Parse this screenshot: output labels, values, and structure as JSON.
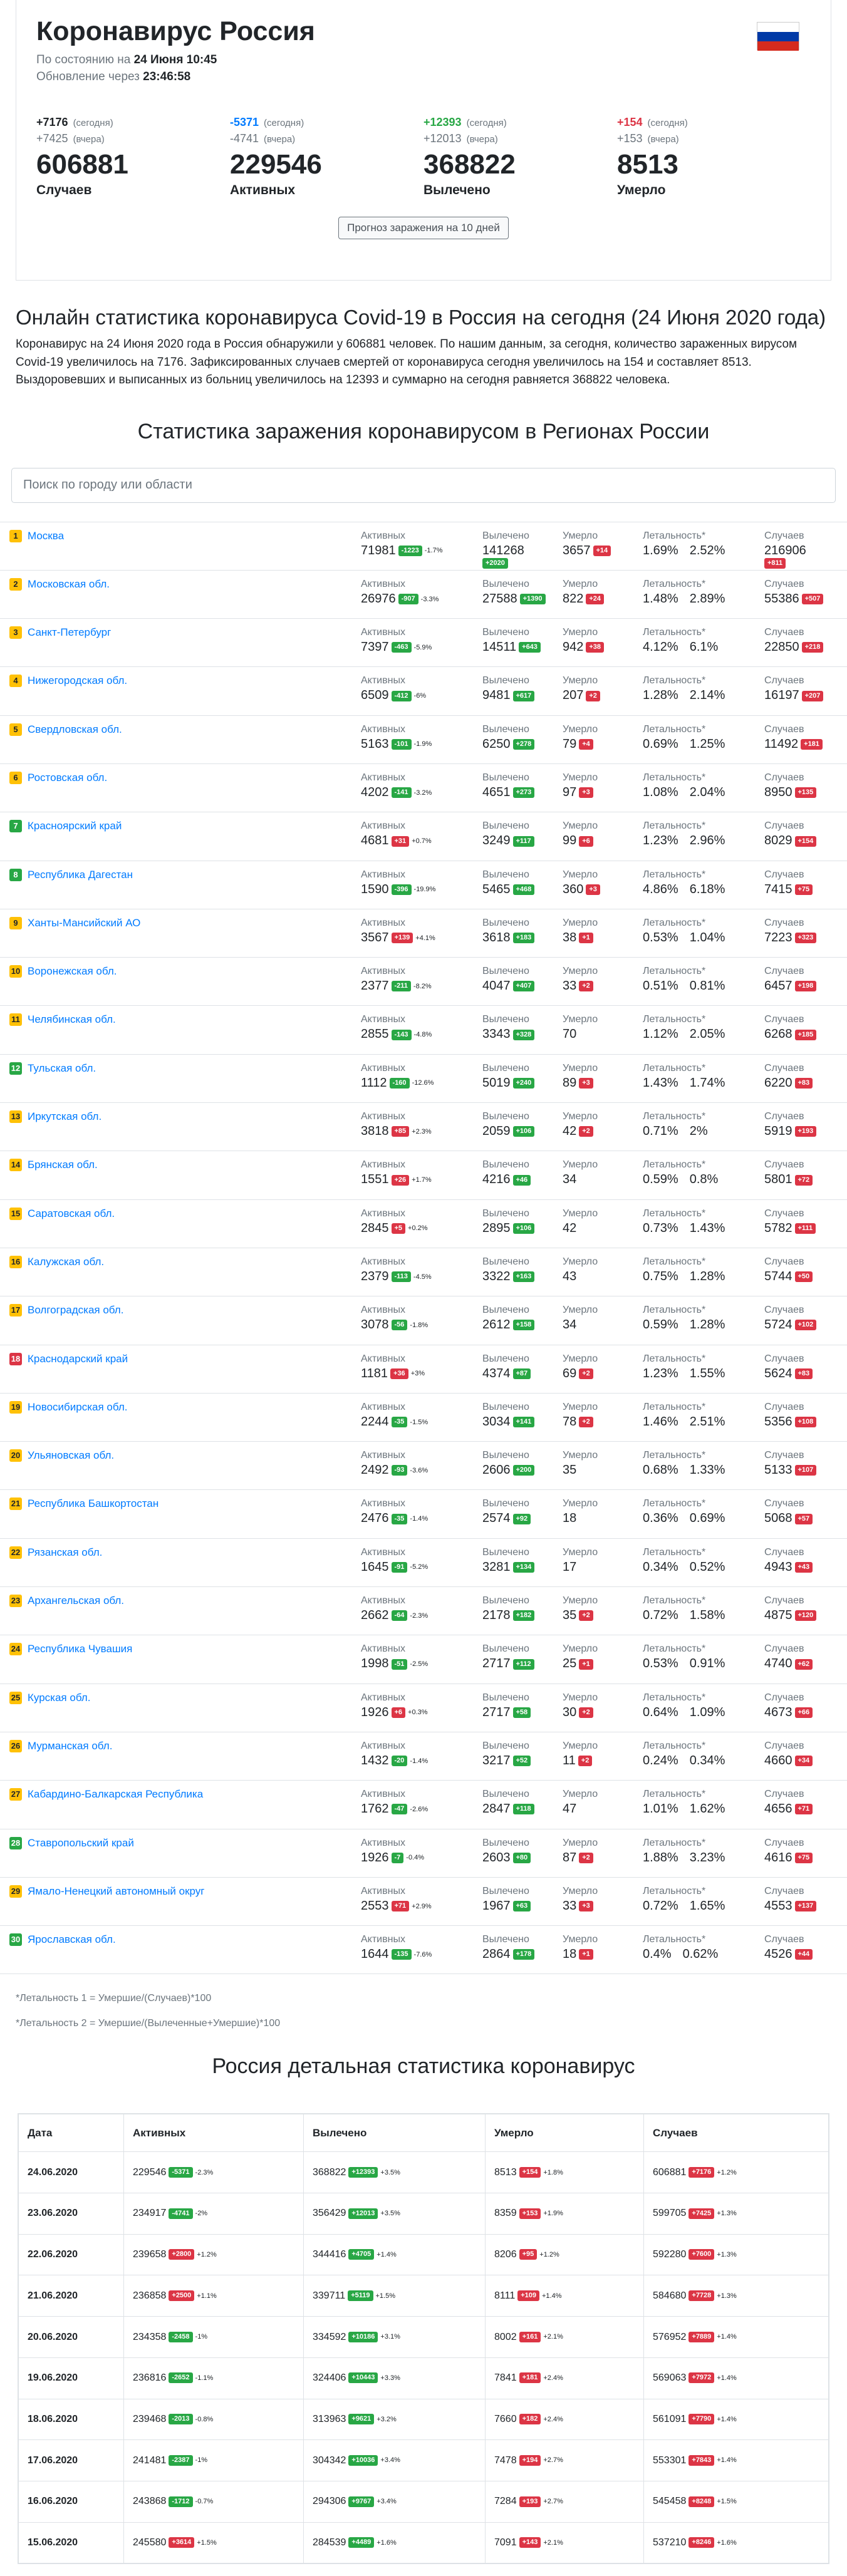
{
  "header": {
    "title": "Коронавирус Россия",
    "status_prefix": "По состоянию на",
    "status_date": "24 Июня 10:45",
    "update_prefix": "Обновление через",
    "update_timer": "23:46:58",
    "flag_colors": [
      "#ffffff",
      "#0039a6",
      "#d52b1e"
    ]
  },
  "stats": [
    {
      "today": "+7176",
      "yesterday": "+7425",
      "total": "606881",
      "label": "Случаев",
      "color": "#212529"
    },
    {
      "today": "-5371",
      "yesterday": "-4741",
      "total": "229546",
      "label": "Активных",
      "color": "#007bff"
    },
    {
      "today": "+12393",
      "yesterday": "+12013",
      "total": "368822",
      "label": "Вылечено",
      "color": "#28a745"
    },
    {
      "today": "+154",
      "yesterday": "+153",
      "total": "8513",
      "label": "Умерло",
      "color": "#dc3545"
    }
  ],
  "stat_labels": {
    "today": "(сегодня)",
    "yesterday": "(вчера)"
  },
  "forecast_button": "Прогноз заражения на 10 дней",
  "intro": {
    "heading": "Онлайн статистика коронавируса Covid-19 в Россия на сегодня (24 Июня 2020 года)",
    "text": "Коронавирус на 24 Июня 2020 года в Россия обнаружили у 606881 человек. По нашим данным, за сегодня, количество зараженных вирусом Covid-19 увеличилось на 7176. Зафиксированных случаев смертей от коронавируса сегодня увеличилось на 154 и составляет 8513. Выздоровевших и выписанных из больниц увеличилось на 12393 и суммарно на сегодня равняется 368822 человека."
  },
  "regions_title": "Статистика заражения коронавирусом в Регионах России",
  "search_placeholder": "Поиск по городу или области",
  "region_labels": {
    "active": "Активных",
    "recovered": "Вылечено",
    "deaths": "Умерло",
    "lethality": "Летальность*",
    "cases": "Случаев"
  },
  "regions": [
    {
      "n": "1",
      "c": "y",
      "name": "Москва",
      "active": "71981",
      "ad": "-1223",
      "ap": "-1.7%",
      "rec": "141268",
      "rd": "+2020",
      "dth": "3657",
      "dd": "+14",
      "l1": "1.69%",
      "l2": "2.52%",
      "cas": "216906",
      "cd": "+811"
    },
    {
      "n": "2",
      "c": "y",
      "name": "Московская обл.",
      "active": "26976",
      "ad": "-907",
      "ap": "-3.3%",
      "rec": "27588",
      "rd": "+1390",
      "dth": "822",
      "dd": "+24",
      "l1": "1.48%",
      "l2": "2.89%",
      "cas": "55386",
      "cd": "+507"
    },
    {
      "n": "3",
      "c": "y",
      "name": "Санкт-Петербург",
      "active": "7397",
      "ad": "-463",
      "ap": "-5.9%",
      "rec": "14511",
      "rd": "+643",
      "dth": "942",
      "dd": "+38",
      "l1": "4.12%",
      "l2": "6.1%",
      "cas": "22850",
      "cd": "+218"
    },
    {
      "n": "4",
      "c": "y",
      "name": "Нижегородская обл.",
      "active": "6509",
      "ad": "-412",
      "ap": "-6%",
      "rec": "9481",
      "rd": "+617",
      "dth": "207",
      "dd": "+2",
      "l1": "1.28%",
      "l2": "2.14%",
      "cas": "16197",
      "cd": "+207"
    },
    {
      "n": "5",
      "c": "y",
      "name": "Свердловская обл.",
      "active": "5163",
      "ad": "-101",
      "ap": "-1.9%",
      "rec": "6250",
      "rd": "+278",
      "dth": "79",
      "dd": "+4",
      "l1": "0.69%",
      "l2": "1.25%",
      "cas": "11492",
      "cd": "+181"
    },
    {
      "n": "6",
      "c": "y",
      "name": "Ростовская обл.",
      "active": "4202",
      "ad": "-141",
      "ap": "-3.2%",
      "rec": "4651",
      "rd": "+273",
      "dth": "97",
      "dd": "+3",
      "l1": "1.08%",
      "l2": "2.04%",
      "cas": "8950",
      "cd": "+135"
    },
    {
      "n": "7",
      "c": "g",
      "name": "Красноярский край",
      "active": "4681",
      "ad": "+31",
      "ap": "+0.7%",
      "rec": "3249",
      "rd": "+117",
      "dth": "99",
      "dd": "+6",
      "l1": "1.23%",
      "l2": "2.96%",
      "cas": "8029",
      "cd": "+154"
    },
    {
      "n": "8",
      "c": "g",
      "name": "Республика Дагестан",
      "active": "1590",
      "ad": "-396",
      "ap": "-19.9%",
      "rec": "5465",
      "rd": "+468",
      "dth": "360",
      "dd": "+3",
      "l1": "4.86%",
      "l2": "6.18%",
      "cas": "7415",
      "cd": "+75"
    },
    {
      "n": "9",
      "c": "y",
      "name": "Ханты-Мансийский АО",
      "active": "3567",
      "ad": "+139",
      "ap": "+4.1%",
      "rec": "3618",
      "rd": "+183",
      "dth": "38",
      "dd": "+1",
      "l1": "0.53%",
      "l2": "1.04%",
      "cas": "7223",
      "cd": "+323"
    },
    {
      "n": "10",
      "c": "y",
      "name": "Воронежская обл.",
      "active": "2377",
      "ad": "-211",
      "ap": "-8.2%",
      "rec": "4047",
      "rd": "+407",
      "dth": "33",
      "dd": "+2",
      "l1": "0.51%",
      "l2": "0.81%",
      "cas": "6457",
      "cd": "+198"
    },
    {
      "n": "11",
      "c": "y",
      "name": "Челябинская обл.",
      "active": "2855",
      "ad": "-143",
      "ap": "-4.8%",
      "rec": "3343",
      "rd": "+328",
      "dth": "70",
      "dd": "",
      "l1": "1.12%",
      "l2": "2.05%",
      "cas": "6268",
      "cd": "+185"
    },
    {
      "n": "12",
      "c": "g",
      "name": "Тульская обл.",
      "active": "1112",
      "ad": "-160",
      "ap": "-12.6%",
      "rec": "5019",
      "rd": "+240",
      "dth": "89",
      "dd": "+3",
      "l1": "1.43%",
      "l2": "1.74%",
      "cas": "6220",
      "cd": "+83"
    },
    {
      "n": "13",
      "c": "y",
      "name": "Иркутская обл.",
      "active": "3818",
      "ad": "+85",
      "ap": "+2.3%",
      "rec": "2059",
      "rd": "+106",
      "dth": "42",
      "dd": "+2",
      "l1": "0.71%",
      "l2": "2%",
      "cas": "5919",
      "cd": "+193"
    },
    {
      "n": "14",
      "c": "y",
      "name": "Брянская обл.",
      "active": "1551",
      "ad": "+26",
      "ap": "+1.7%",
      "rec": "4216",
      "rd": "+46",
      "dth": "34",
      "dd": "",
      "l1": "0.59%",
      "l2": "0.8%",
      "cas": "5801",
      "cd": "+72"
    },
    {
      "n": "15",
      "c": "y",
      "name": "Саратовская обл.",
      "active": "2845",
      "ad": "+5",
      "ap": "+0.2%",
      "rec": "2895",
      "rd": "+106",
      "dth": "42",
      "dd": "",
      "l1": "0.73%",
      "l2": "1.43%",
      "cas": "5782",
      "cd": "+111"
    },
    {
      "n": "16",
      "c": "y",
      "name": "Калужская обл.",
      "active": "2379",
      "ad": "-113",
      "ap": "-4.5%",
      "rec": "3322",
      "rd": "+163",
      "dth": "43",
      "dd": "",
      "l1": "0.75%",
      "l2": "1.28%",
      "cas": "5744",
      "cd": "+50"
    },
    {
      "n": "17",
      "c": "y",
      "name": "Волгоградская обл.",
      "active": "3078",
      "ad": "-56",
      "ap": "-1.8%",
      "rec": "2612",
      "rd": "+158",
      "dth": "34",
      "dd": "",
      "l1": "0.59%",
      "l2": "1.28%",
      "cas": "5724",
      "cd": "+102"
    },
    {
      "n": "18",
      "c": "r",
      "name": "Краснодарский край",
      "active": "1181",
      "ad": "+36",
      "ap": "+3%",
      "rec": "4374",
      "rd": "+87",
      "dth": "69",
      "dd": "+2",
      "l1": "1.23%",
      "l2": "1.55%",
      "cas": "5624",
      "cd": "+83"
    },
    {
      "n": "19",
      "c": "y",
      "name": "Новосибирская обл.",
      "active": "2244",
      "ad": "-35",
      "ap": "-1.5%",
      "rec": "3034",
      "rd": "+141",
      "dth": "78",
      "dd": "+2",
      "l1": "1.46%",
      "l2": "2.51%",
      "cas": "5356",
      "cd": "+108"
    },
    {
      "n": "20",
      "c": "y",
      "name": "Ульяновская обл.",
      "active": "2492",
      "ad": "-93",
      "ap": "-3.6%",
      "rec": "2606",
      "rd": "+200",
      "dth": "35",
      "dd": "",
      "l1": "0.68%",
      "l2": "1.33%",
      "cas": "5133",
      "cd": "+107"
    },
    {
      "n": "21",
      "c": "y",
      "name": "Республика Башкортостан",
      "active": "2476",
      "ad": "-35",
      "ap": "-1.4%",
      "rec": "2574",
      "rd": "+92",
      "dth": "18",
      "dd": "",
      "l1": "0.36%",
      "l2": "0.69%",
      "cas": "5068",
      "cd": "+57"
    },
    {
      "n": "22",
      "c": "y",
      "name": "Рязанская обл.",
      "active": "1645",
      "ad": "-91",
      "ap": "-5.2%",
      "rec": "3281",
      "rd": "+134",
      "dth": "17",
      "dd": "",
      "l1": "0.34%",
      "l2": "0.52%",
      "cas": "4943",
      "cd": "+43"
    },
    {
      "n": "23",
      "c": "y",
      "name": "Архангельская обл.",
      "active": "2662",
      "ad": "-64",
      "ap": "-2.3%",
      "rec": "2178",
      "rd": "+182",
      "dth": "35",
      "dd": "+2",
      "l1": "0.72%",
      "l2": "1.58%",
      "cas": "4875",
      "cd": "+120"
    },
    {
      "n": "24",
      "c": "y",
      "name": "Республика Чувашия",
      "active": "1998",
      "ad": "-51",
      "ap": "-2.5%",
      "rec": "2717",
      "rd": "+112",
      "dth": "25",
      "dd": "+1",
      "l1": "0.53%",
      "l2": "0.91%",
      "cas": "4740",
      "cd": "+62"
    },
    {
      "n": "25",
      "c": "y",
      "name": "Курская обл.",
      "active": "1926",
      "ad": "+6",
      "ap": "+0.3%",
      "rec": "2717",
      "rd": "+58",
      "dth": "30",
      "dd": "+2",
      "l1": "0.64%",
      "l2": "1.09%",
      "cas": "4673",
      "cd": "+66"
    },
    {
      "n": "26",
      "c": "y",
      "name": "Мурманская обл.",
      "active": "1432",
      "ad": "-20",
      "ap": "-1.4%",
      "rec": "3217",
      "rd": "+52",
      "dth": "11",
      "dd": "+2",
      "l1": "0.24%",
      "l2": "0.34%",
      "cas": "4660",
      "cd": "+34"
    },
    {
      "n": "27",
      "c": "y",
      "name": "Кабардино-Балкарская Республика",
      "active": "1762",
      "ad": "-47",
      "ap": "-2.6%",
      "rec": "2847",
      "rd": "+118",
      "dth": "47",
      "dd": "",
      "l1": "1.01%",
      "l2": "1.62%",
      "cas": "4656",
      "cd": "+71"
    },
    {
      "n": "28",
      "c": "g",
      "name": "Ставропольский край",
      "active": "1926",
      "ad": "-7",
      "ap": "-0.4%",
      "rec": "2603",
      "rd": "+80",
      "dth": "87",
      "dd": "+2",
      "l1": "1.88%",
      "l2": "3.23%",
      "cas": "4616",
      "cd": "+75"
    },
    {
      "n": "29",
      "c": "y",
      "name": "Ямало-Ненецкий автономный округ",
      "active": "2553",
      "ad": "+71",
      "ap": "+2.9%",
      "rec": "1967",
      "rd": "+63",
      "dth": "33",
      "dd": "+3",
      "l1": "0.72%",
      "l2": "1.65%",
      "cas": "4553",
      "cd": "+137"
    },
    {
      "n": "30",
      "c": "g",
      "name": "Ярославская обл.",
      "active": "1644",
      "ad": "-135",
      "ap": "-7.6%",
      "rec": "2864",
      "rd": "+178",
      "dth": "18",
      "dd": "+1",
      "l1": "0.4%",
      "l2": "0.62%",
      "cas": "4526",
      "cd": "+44"
    }
  ],
  "notes": {
    "n1": "*Летальность 1 = Умершие/(Случаев)*100",
    "n2": "*Летальность 2 = Умершие/(Вылеченные+Умершие)*100"
  },
  "daily_title": "Россия детальная статистика коронавирус",
  "daily_headers": [
    "Дата",
    "Активных",
    "Вылечено",
    "Умерло",
    "Случаев"
  ],
  "daily": [
    {
      "date": "24.06.2020",
      "a": "229546",
      "ad": "-5371",
      "ap": "-2.3%",
      "r": "368822",
      "rd": "+12393",
      "rp": "+3.5%",
      "d": "8513",
      "dd": "+154",
      "dp": "+1.8%",
      "c": "606881",
      "cd": "+7176",
      "cp": "+1.2%"
    },
    {
      "date": "23.06.2020",
      "a": "234917",
      "ad": "-4741",
      "ap": "-2%",
      "r": "356429",
      "rd": "+12013",
      "rp": "+3.5%",
      "d": "8359",
      "dd": "+153",
      "dp": "+1.9%",
      "c": "599705",
      "cd": "+7425",
      "cp": "+1.3%"
    },
    {
      "date": "22.06.2020",
      "a": "239658",
      "ad": "+2800",
      "ap": "+1.2%",
      "r": "344416",
      "rd": "+4705",
      "rp": "+1.4%",
      "d": "8206",
      "dd": "+95",
      "dp": "+1.2%",
      "c": "592280",
      "cd": "+7600",
      "cp": "+1.3%"
    },
    {
      "date": "21.06.2020",
      "a": "236858",
      "ad": "+2500",
      "ap": "+1.1%",
      "r": "339711",
      "rd": "+5119",
      "rp": "+1.5%",
      "d": "8111",
      "dd": "+109",
      "dp": "+1.4%",
      "c": "584680",
      "cd": "+7728",
      "cp": "+1.3%"
    },
    {
      "date": "20.06.2020",
      "a": "234358",
      "ad": "-2458",
      "ap": "-1%",
      "r": "334592",
      "rd": "+10186",
      "rp": "+3.1%",
      "d": "8002",
      "dd": "+161",
      "dp": "+2.1%",
      "c": "576952",
      "cd": "+7889",
      "cp": "+1.4%"
    },
    {
      "date": "19.06.2020",
      "a": "236816",
      "ad": "-2652",
      "ap": "-1.1%",
      "r": "324406",
      "rd": "+10443",
      "rp": "+3.3%",
      "d": "7841",
      "dd": "+181",
      "dp": "+2.4%",
      "c": "569063",
      "cd": "+7972",
      "cp": "+1.4%"
    },
    {
      "date": "18.06.2020",
      "a": "239468",
      "ad": "-2013",
      "ap": "-0.8%",
      "r": "313963",
      "rd": "+9621",
      "rp": "+3.2%",
      "d": "7660",
      "dd": "+182",
      "dp": "+2.4%",
      "c": "561091",
      "cd": "+7790",
      "cp": "+1.4%"
    },
    {
      "date": "17.06.2020",
      "a": "241481",
      "ad": "-2387",
      "ap": "-1%",
      "r": "304342",
      "rd": "+10036",
      "rp": "+3.4%",
      "d": "7478",
      "dd": "+194",
      "dp": "+2.7%",
      "c": "553301",
      "cd": "+7843",
      "cp": "+1.4%"
    },
    {
      "date": "16.06.2020",
      "a": "243868",
      "ad": "-1712",
      "ap": "-0.7%",
      "r": "294306",
      "rd": "+9767",
      "rp": "+3.4%",
      "d": "7284",
      "dd": "+193",
      "dp": "+2.7%",
      "c": "545458",
      "cd": "+8248",
      "cp": "+1.5%"
    },
    {
      "date": "15.06.2020",
      "a": "245580",
      "ad": "+3614",
      "ap": "+1.5%",
      "r": "284539",
      "rd": "+4489",
      "rp": "+1.6%",
      "d": "7091",
      "dd": "+143",
      "dp": "+2.1%",
      "c": "537210",
      "cd": "+8246",
      "cp": "+1.6%"
    }
  ]
}
